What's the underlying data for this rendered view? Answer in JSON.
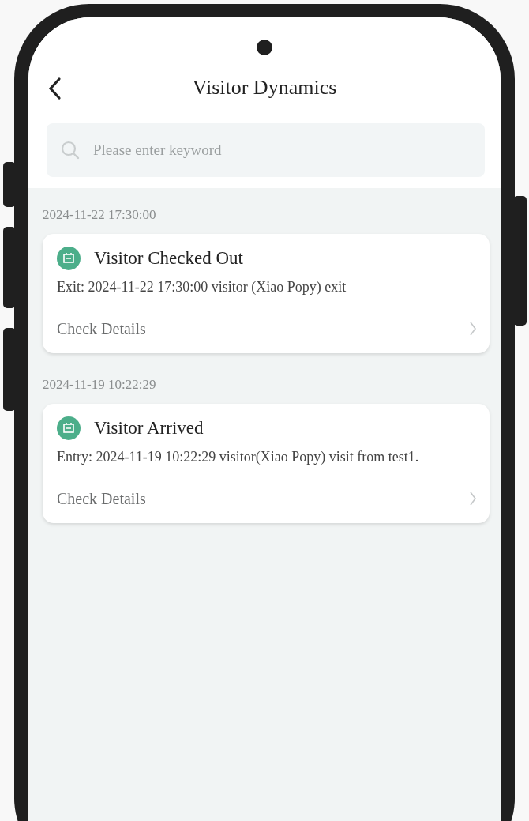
{
  "header": {
    "title": "Visitor Dynamics"
  },
  "search": {
    "placeholder": "Please enter keyword"
  },
  "events": [
    {
      "date": "2024-11-22 17:30:00",
      "title": "Visitor Checked Out",
      "description": "Exit: 2024-11-22 17:30:00 visitor (Xiao Popy) exit",
      "link": "Check Details"
    },
    {
      "date": "2024-11-19 10:22:29",
      "title": "Visitor Arrived",
      "description": "Entry: 2024-11-19 10:22:29 visitor(Xiao Popy) visit from test1.",
      "link": "Check Details"
    }
  ]
}
